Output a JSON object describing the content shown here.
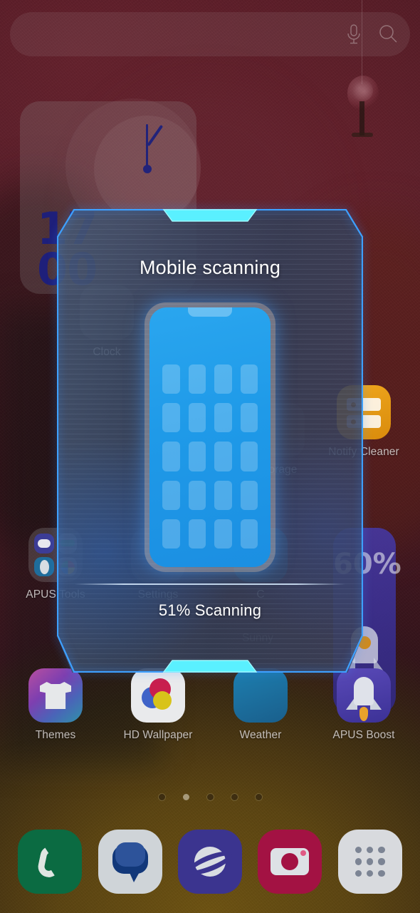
{
  "wallpaper": {
    "decoration": "hanging-blossom-tree"
  },
  "search": {
    "placeholder": "",
    "value": "",
    "mic_icon": "microphone-icon",
    "search_icon": "search-icon"
  },
  "clock_widget": {
    "hour": "17",
    "minute": "00",
    "label": "Clock"
  },
  "home": {
    "apps": [
      {
        "label": "Clock",
        "icon": "clock-icon"
      },
      {
        "label": "Storage",
        "icon": "storage-icon"
      },
      {
        "label": "Notify Cleaner",
        "icon": "notify-cleaner-icon"
      },
      {
        "label": "APUS Tools",
        "icon": "apus-tools-folder-icon"
      },
      {
        "label": "Settings",
        "icon": "settings-icon"
      },
      {
        "label": "Themes",
        "icon": "themes-icon"
      },
      {
        "label": "HD Wallpaper",
        "icon": "hd-wallpaper-icon"
      },
      {
        "label": "Weather",
        "icon": "weather-icon"
      },
      {
        "label": "APUS Boost",
        "icon": "apus-boost-icon"
      }
    ],
    "weather_widget": {
      "condition": "Sunny",
      "temperature": "C"
    },
    "boost_widget": {
      "percent": "60%",
      "icon": "rocket-icon"
    },
    "page_dots": {
      "count": 5,
      "active_index": 1
    }
  },
  "dock": {
    "items": [
      {
        "label": "Phone",
        "icon": "phone-icon"
      },
      {
        "label": "Messages",
        "icon": "message-bubble-icon"
      },
      {
        "label": "Internet",
        "icon": "browser-planet-icon"
      },
      {
        "label": "Camera",
        "icon": "camera-icon"
      },
      {
        "label": "Apps",
        "icon": "app-drawer-icon"
      }
    ]
  },
  "scan_overlay": {
    "title": "Mobile scanning",
    "status": "51% Scanning",
    "progress_percent": 51,
    "phone_graphic": {
      "rows": 5,
      "cols": 4,
      "icon": "phone-with-apps-graphic"
    },
    "colors": {
      "accent_cyan": "#63f2ff",
      "border_blue": "#2f8fff",
      "panel_slate": "#36404f",
      "screen_blue": "#1f9ae8"
    }
  }
}
